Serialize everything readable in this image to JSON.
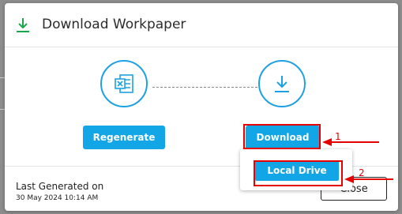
{
  "dialog": {
    "title": "Download Workpaper",
    "icons": {
      "header": "download-icon",
      "regenerate": "excel-file-icon",
      "download": "download-icon"
    }
  },
  "actions": {
    "regenerate_label": "Regenerate",
    "download_label": "Download"
  },
  "footer": {
    "last_generated_label": "Last Generated on",
    "last_generated_date": "30 May 2024 10:14 AM",
    "close_label": "Close"
  },
  "download_menu": {
    "items": [
      {
        "label": "Local Drive"
      }
    ]
  },
  "annotations": {
    "step1": "1",
    "step2": "2"
  },
  "colors": {
    "accent": "#13a6e6",
    "header_icon": "#1aa64a",
    "annotation": "#e60000"
  }
}
